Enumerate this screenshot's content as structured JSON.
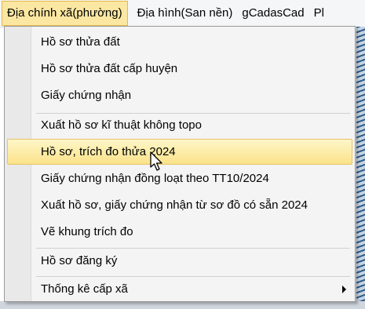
{
  "menubar": {
    "items": [
      {
        "label": "Địa chính xã(phường)"
      },
      {
        "label": "Địa hình(San nền)"
      },
      {
        "label": "gCadasCad"
      },
      {
        "label": "Pl"
      }
    ]
  },
  "dropdown": {
    "items": [
      {
        "label": "Hồ sơ thửa đất"
      },
      {
        "label": "Hồ sơ thửa đất cấp huyện"
      },
      {
        "label": "Giấy chứng nhận"
      },
      {
        "label": "Xuất hồ sơ kĩ thuật không topo"
      },
      {
        "label": "Hồ sơ, trích đo thửa 2024"
      },
      {
        "label": "Giấy chứng nhận đồng loạt theo TT10/2024"
      },
      {
        "label": "Xuất hồ sơ, giấy chứng nhận từ sơ đồ có sẵn 2024"
      },
      {
        "label": "Vẽ khung trích đo"
      },
      {
        "label": "Hồ sơ đăng ký"
      },
      {
        "label": "Thống kê cấp xã"
      }
    ]
  },
  "colors": {
    "highlight": "#fbe38a",
    "menu_background": "#f4f4f4"
  }
}
